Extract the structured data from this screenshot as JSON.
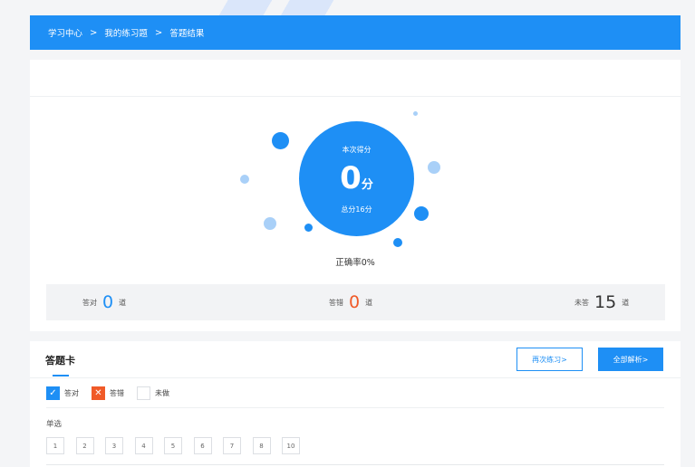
{
  "breadcrumb": {
    "items": [
      "学习中心",
      "我的练习题",
      "答题结果"
    ],
    "separator": ">"
  },
  "result": {
    "score_label": "本次得分",
    "score_value": "0",
    "score_unit": "分",
    "total_label": "总分16分",
    "accuracy": "正确率0%"
  },
  "stats": {
    "correct": {
      "label": "答对",
      "count": "0",
      "unit": "道",
      "color": "#1e8ff5"
    },
    "wrong": {
      "label": "答错",
      "count": "0",
      "unit": "道",
      "color": "#f05a28"
    },
    "unanswered": {
      "label": "未答",
      "count": "15",
      "unit": "道",
      "color": "#333333"
    }
  },
  "answer_card": {
    "title": "答题卡",
    "retry_label": "再次练习>",
    "analysis_label": "全部解析>",
    "legend": {
      "correct": "答对",
      "wrong": "答错",
      "blank": "未做"
    },
    "section": "单选",
    "questions": [
      "1",
      "2",
      "3",
      "4",
      "5",
      "6",
      "7",
      "8",
      "10"
    ]
  },
  "colors": {
    "primary": "#1e8ff5",
    "error": "#f05a28",
    "light_blue": "#a9d0f8"
  },
  "icons": {
    "separator": "chevron-right-icon",
    "correct": "check-icon",
    "wrong": "close-icon"
  }
}
